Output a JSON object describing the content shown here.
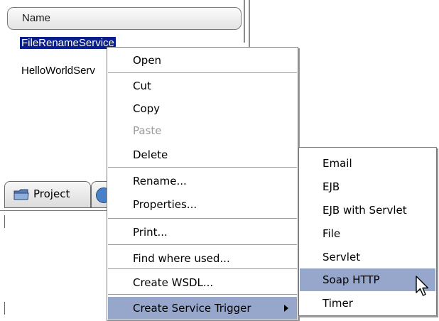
{
  "panel": {
    "column_header": "Name",
    "items": [
      {
        "label": "FileRenameService",
        "selected": true
      },
      {
        "label": "HelloWorldServ",
        "selected": false
      }
    ],
    "tabs": {
      "project_label": "Project"
    }
  },
  "context_menu": {
    "items": [
      {
        "label": "Open",
        "enabled": true
      },
      {
        "label": "Cut",
        "enabled": true
      },
      {
        "label": "Copy",
        "enabled": true
      },
      {
        "label": "Paste",
        "enabled": false
      },
      {
        "label": "Delete",
        "enabled": true
      },
      {
        "label": "Rename...",
        "enabled": true
      },
      {
        "label": "Properties...",
        "enabled": true
      },
      {
        "label": "Print...",
        "enabled": true
      },
      {
        "label": "Find where used...",
        "enabled": true
      },
      {
        "label": "Create WSDL...",
        "enabled": true
      },
      {
        "label": "Create Service Trigger",
        "enabled": true,
        "highlighted": true,
        "has_submenu": true
      }
    ]
  },
  "submenu": {
    "items": [
      {
        "label": "Email"
      },
      {
        "label": "EJB"
      },
      {
        "label": "EJB with Servlet"
      },
      {
        "label": "File"
      },
      {
        "label": "Servlet"
      },
      {
        "label": "Soap HTTP",
        "highlighted": true
      },
      {
        "label": "Timer"
      }
    ]
  },
  "colors": {
    "selection": "#0b1f8c",
    "menu_highlight": "#97a7cc",
    "disabled_text": "#9a9a9a"
  },
  "icons": {
    "project_tab": "folder-icon",
    "other_tab": "globe-icon",
    "submenu_arrow": "chevron-right-icon",
    "pointer": "mouse-pointer-icon"
  }
}
